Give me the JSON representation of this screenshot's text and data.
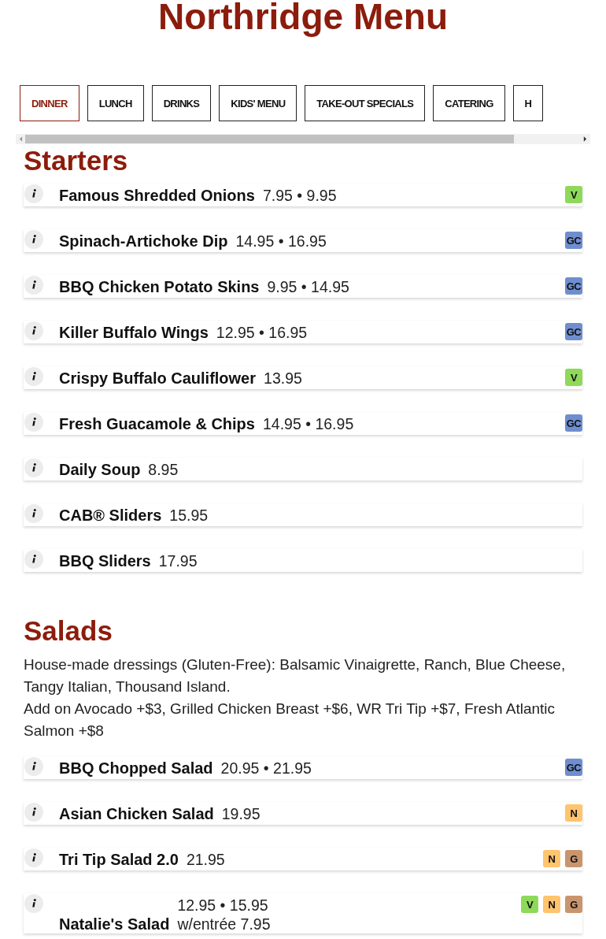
{
  "title": "Northridge Menu",
  "tabs": [
    {
      "label": "DINNER",
      "selected": true
    },
    {
      "label": "LUNCH",
      "selected": false
    },
    {
      "label": "DRINKS",
      "selected": false
    },
    {
      "label": "KIDS' MENU",
      "selected": false
    },
    {
      "label": "TAKE-OUT SPECIALS",
      "selected": false
    },
    {
      "label": "CATERING",
      "selected": false
    },
    {
      "label": "H",
      "selected": false
    }
  ],
  "sections": [
    {
      "heading": "Starters",
      "items": [
        {
          "name": "Famous Shredded Onions",
          "prices": [
            "7.95 • 9.95"
          ],
          "badges": [
            {
              "label": "V",
              "color": "#8fd95a"
            }
          ]
        },
        {
          "name": "Spinach-Artichoke Dip",
          "prices": [
            "14.95 • 16.95"
          ],
          "badges": [
            {
              "label": "GC",
              "color": "#6f8ecf"
            }
          ]
        },
        {
          "name": "BBQ Chicken Potato Skins",
          "prices": [
            "9.95 • 14.95"
          ],
          "badges": [
            {
              "label": "GC",
              "color": "#6f8ecf"
            }
          ]
        },
        {
          "name": "Killer Buffalo Wings",
          "prices": [
            "12.95 • 16.95"
          ],
          "badges": [
            {
              "label": "GC",
              "color": "#6f8ecf"
            }
          ]
        },
        {
          "name": "Crispy Buffalo Cauliflower",
          "prices": [
            "13.95"
          ],
          "badges": [
            {
              "label": "V",
              "color": "#8fd95a"
            }
          ]
        },
        {
          "name": "Fresh Guacamole & Chips",
          "prices": [
            "14.95 • 16.95"
          ],
          "badges": [
            {
              "label": "GC",
              "color": "#6f8ecf"
            }
          ]
        },
        {
          "name": "Daily Soup",
          "prices": [
            "8.95"
          ]
        },
        {
          "name": "CAB® Sliders",
          "prices": [
            "15.95"
          ]
        },
        {
          "name": "BBQ Sliders",
          "prices": [
            "17.95"
          ]
        }
      ]
    },
    {
      "heading": "Salads",
      "notes": [
        "House-made dressings (Gluten-Free): Balsamic Vinaigrette, Ranch, Blue Cheese, Tangy Italian, Thousand Island.",
        "Add on Avocado +$3, Grilled Chicken Breast +$6, WR Tri Tip +$7, Fresh Atlantic Salmon +$8"
      ],
      "items": [
        {
          "name": "BBQ Chopped Salad",
          "prices": [
            "20.95 • 21.95"
          ],
          "badges": [
            {
              "label": "GC",
              "color": "#6f8ecf"
            }
          ]
        },
        {
          "name": "Asian Chicken Salad",
          "prices": [
            "19.95"
          ],
          "badges": [
            {
              "label": "N",
              "color": "#ffc46e"
            }
          ]
        },
        {
          "name": "Tri Tip Salad 2.0",
          "prices": [
            "21.95"
          ],
          "badges": [
            {
              "label": "N",
              "color": "#ffc46e"
            },
            {
              "label": "G",
              "color": "#c9956e"
            }
          ]
        },
        {
          "name": "Natalie's Salad",
          "prices": [
            "12.95 • 15.95",
            "w/entrée 7.95"
          ],
          "badges": [
            {
              "label": "V",
              "color": "#8fd95a"
            },
            {
              "label": "N",
              "color": "#ffc46e"
            },
            {
              "label": "G",
              "color": "#c9956e"
            }
          ]
        }
      ]
    }
  ]
}
